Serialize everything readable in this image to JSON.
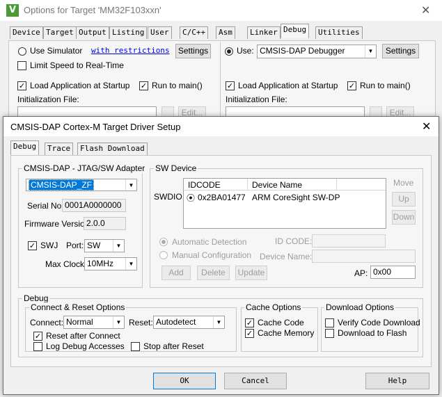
{
  "bg_window": {
    "title": "Options for Target 'MM32F103xxn'",
    "tabs": [
      "Device",
      "Target",
      "Output",
      "Listing",
      "User",
      "C/C++",
      "Asm",
      "Linker",
      "Debug",
      "Utilities"
    ],
    "active_tab": "Debug",
    "left": {
      "use_simulator": "Use Simulator",
      "with_restrictions": "with restrictions",
      "settings": "Settings",
      "limit_speed": "Limit Speed to Real-Time",
      "load_app": "Load Application at Startup",
      "run_to_main": "Run to main()",
      "init_file": "Initialization File:",
      "edit": "Edit..."
    },
    "right": {
      "use": "Use:",
      "debugger": "CMSIS-DAP Debugger",
      "settings": "Settings",
      "load_app": "Load Application at Startup",
      "run_to_main": "Run to main()",
      "init_file": "Initialization File:",
      "edit": "Edit..."
    }
  },
  "dialog": {
    "title": "CMSIS-DAP Cortex-M Target Driver Setup",
    "tabs": [
      "Debug",
      "Trace",
      "Flash Download"
    ],
    "active_tab": "Debug",
    "adapter": {
      "group_title": "CMSIS-DAP - JTAG/SW Adapter",
      "selected_adapter": "CMSIS-DAP_ZF",
      "serial_label": "Serial No:",
      "serial_value": "0001A0000000",
      "firmware_label": "Firmware Version:",
      "firmware_value": "2.0.0",
      "swj_label": "SWJ",
      "port_label": "Port:",
      "port_value": "SW",
      "max_clock_label": "Max Clock:",
      "max_clock_value": "10MHz"
    },
    "sw_device": {
      "group_title": "SW Device",
      "swdio_label": "SWDIO",
      "columns": [
        "IDCODE",
        "Device Name"
      ],
      "rows": [
        {
          "idcode": "0x2BA01477",
          "device": "ARM CoreSight SW-DP"
        }
      ],
      "move": "Move",
      "up": "Up",
      "down": "Down",
      "auto_detection": "Automatic Detection",
      "manual_config": "Manual Configuration",
      "id_code_label": "ID CODE:",
      "device_name_label": "Device Name:",
      "add": "Add",
      "delete": "Delete",
      "update": "Update",
      "ap_label": "AP:",
      "ap_value": "0x00"
    },
    "debug": {
      "group_title": "Debug",
      "connect_reset": {
        "title": "Connect & Reset Options",
        "connect_label": "Connect:",
        "connect_value": "Normal",
        "reset_label": "Reset:",
        "reset_value": "Autodetect",
        "reset_after_connect": "Reset after Connect",
        "log_debug": "Log Debug Accesses",
        "stop_after_reset": "Stop after Reset"
      },
      "cache": {
        "title": "Cache Options",
        "cache_code": "Cache Code",
        "cache_memory": "Cache Memory"
      },
      "download": {
        "title": "Download Options",
        "verify": "Verify Code Download",
        "download_flash": "Download to Flash"
      }
    },
    "buttons": {
      "ok": "OK",
      "cancel": "Cancel",
      "help": "Help"
    }
  },
  "colors": {
    "selection": "#0078d7",
    "link": "#0000ee",
    "keil_icon": "#4a9a36"
  }
}
